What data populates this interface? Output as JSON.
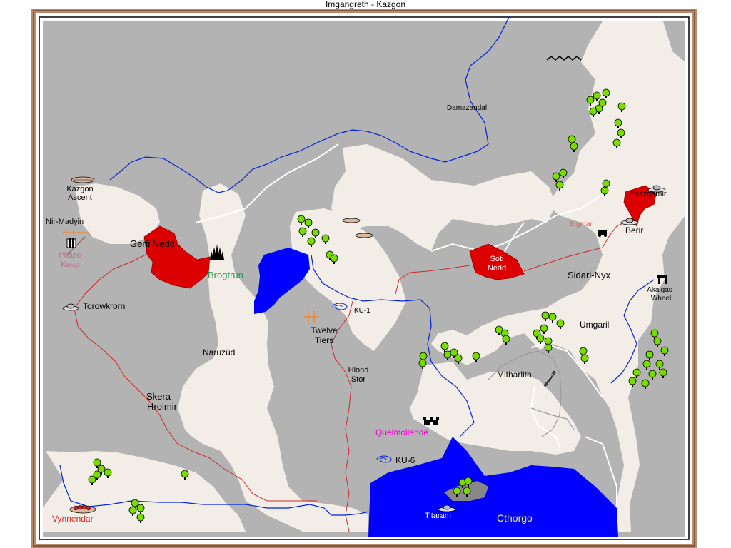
{
  "window": {
    "title": "Imgangreth - Kazgon"
  },
  "colors": {
    "frame": "#b98a6e",
    "sea": "#b3b3b3",
    "land": "#f3ede7",
    "nation": "#dd0000",
    "lake": "#0000ff",
    "river": "#0022dd",
    "road": "#cc2a2a",
    "border": "#ffffff",
    "tree": "#77dd00",
    "label_default": "#000000",
    "label_green": "#229955",
    "label_pink": "#cc6699",
    "label_magenta": "#ee00cc",
    "label_red": "#ee2222",
    "label_salmon": "#dd6655",
    "label_white": "#ffffff",
    "label_yellow": "#eeee66"
  },
  "labels": {
    "damazandal": "Damazandal",
    "kazgon_ascent_1": "Kazgon",
    "kazgon_ascent_2": "Ascent",
    "nir_madyin": "Nir-Madyin",
    "phaze_keep_1": "Phaze",
    "phaze_keep_2": "Keep",
    "gerti_nedd": "Gerti Nedd",
    "brogtrun": "Brogtrun",
    "torowkrorn": "Torowkrorn",
    "ku1": "KU-1",
    "twelve_tiers_1": "Twelve",
    "twelve_tiers_2": "Tiers",
    "naruzud": "Naruzûd",
    "hlond_stor_1": "Hlond",
    "hlond_stor_2": "Stor",
    "skera_hrolmir_1": "Skera",
    "skera_hrolmir_2": "Hrolmir",
    "soti_nedd_1": "Soti",
    "soti_nedd_2": "Nedd",
    "phazgamir": "Phazgamir",
    "bigmar": "Bigmar",
    "berir": "Berir",
    "sidari_nyx": "Sidari-Nyx",
    "akalgas_wheel_1": "Akalgas",
    "akalgas_wheel_2": "Wheel",
    "umgaril": "Umgaril",
    "mitharlith": "Mitharlith",
    "quelmollende": "Quelmollendë",
    "ku6": "KU-6",
    "titaram": "Titaram",
    "cthorgo": "Cthorgo",
    "vynnendar": "Vynnendar"
  },
  "icons": [
    "castle-icon",
    "mountain-fortress-icon",
    "airship-icon",
    "ruins-icon",
    "portal-icon",
    "vortex-icon",
    "monolith-icon",
    "tree-icon",
    "crossroads-icon"
  ]
}
